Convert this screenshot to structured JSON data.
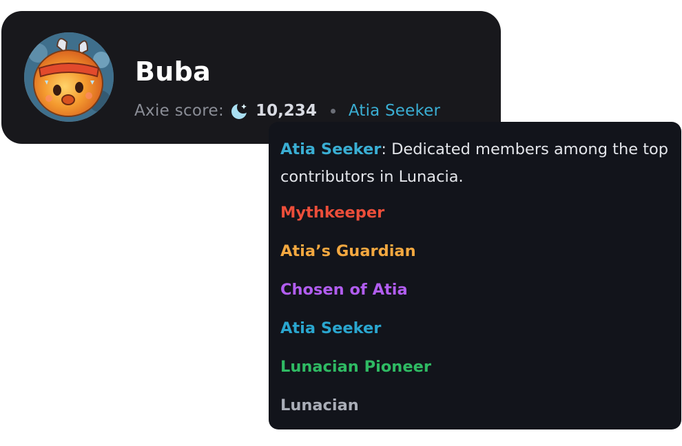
{
  "profile": {
    "name": "Buba",
    "score_label": "Axie score:",
    "score_value": "10,234",
    "rank": "Atia Seeker",
    "score_icon": "crescent-moon-icon",
    "separator": "•"
  },
  "tooltip": {
    "highlight": "Atia Seeker",
    "description": ": Dedicated members among the top contributors in Lunacia.",
    "tiers": [
      {
        "label": "Mythkeeper",
        "color": "#ec4e3a"
      },
      {
        "label": "Atia’s Guardian",
        "color": "#f3a840"
      },
      {
        "label": "Chosen of Atia",
        "color": "#b15df0"
      },
      {
        "label": "Atia Seeker",
        "color": "#2aa6cf"
      },
      {
        "label": "Lunacian Pioneer",
        "color": "#2fba63"
      },
      {
        "label": "Lunacian",
        "color": "#a9adb7"
      }
    ]
  },
  "colors": {
    "card_bg": "#18181c",
    "tooltip_bg": "#12141b",
    "accent": "#3aaed3"
  }
}
